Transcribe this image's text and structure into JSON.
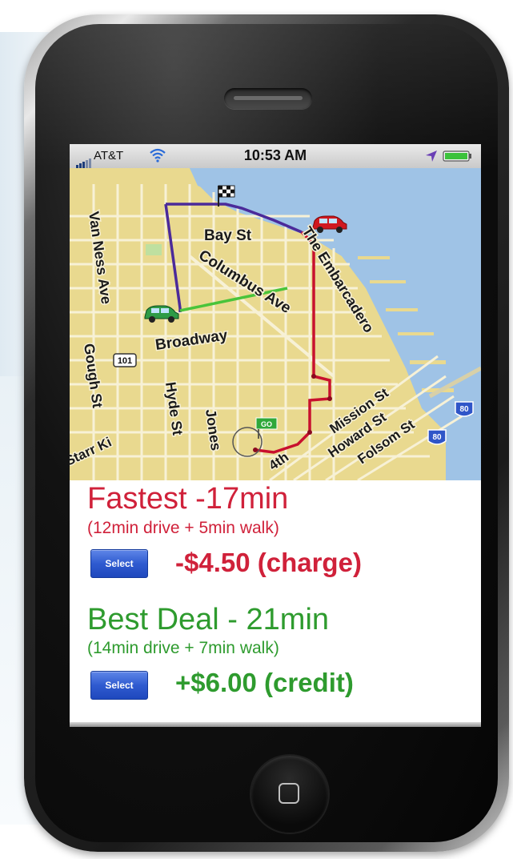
{
  "status_bar": {
    "carrier": "AT&T",
    "time": "10:53 AM",
    "icons": [
      "signal-icon",
      "wifi-icon",
      "location-icon",
      "battery-icon"
    ]
  },
  "map": {
    "labels": {
      "bay_st": "Bay St",
      "columbus_ave": "Columbus Ave",
      "broadway": "Broadway",
      "van_ness_ave": "Van Ness Ave",
      "gough_st": "Gough St",
      "hyde_st": "Hyde St",
      "jones": "Jones",
      "embarcadero": "The Embarcadero",
      "mission_st": "Mission St",
      "howard_st": "Howard St",
      "folsom_st": "Folsom St",
      "fourth": "4th",
      "starr_king": "Starr Ki",
      "shield_101": "101",
      "shield_80a": "80",
      "shield_80b": "80",
      "go_marker": "GO"
    },
    "colors": {
      "land": "#e9d98f",
      "water": "#9fc3e6",
      "street": "#f7f1d6",
      "route_purple": "#4b2a9a",
      "route_red": "#c8102e",
      "route_green": "#49c43a"
    }
  },
  "routes": [
    {
      "title": "Fastest -17min",
      "detail": "(12min drive + 5min walk)",
      "select_label": "Select",
      "price": "-$4.50 (charge)",
      "color": "#d0213a"
    },
    {
      "title": "Best Deal - 21min",
      "detail": "(14min drive + 7min walk)",
      "select_label": "Select",
      "price": "+$6.00 (credit)",
      "color": "#2e9b2e"
    }
  ]
}
